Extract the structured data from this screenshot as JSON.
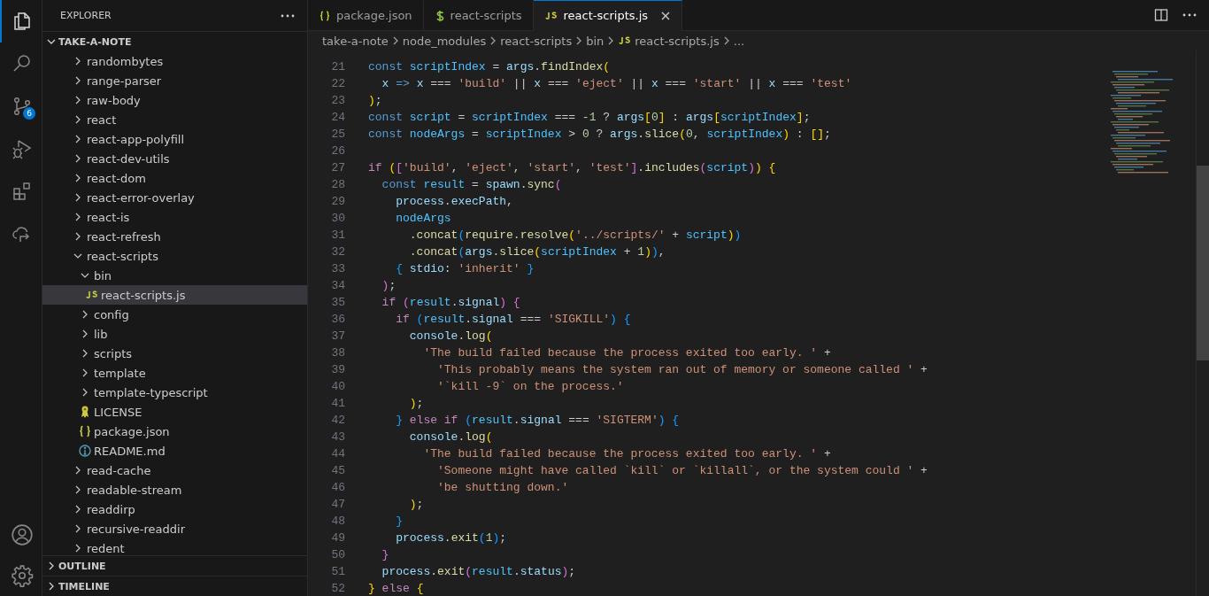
{
  "activity_bar": {
    "items": [
      {
        "kind": "explorer",
        "selected": true
      },
      {
        "kind": "search",
        "selected": false
      },
      {
        "kind": "source-control",
        "selected": false,
        "badge": "6"
      },
      {
        "kind": "run-debug",
        "selected": false
      },
      {
        "kind": "extensions",
        "selected": false
      },
      {
        "kind": "remote",
        "selected": false
      }
    ],
    "bottom": [
      {
        "kind": "account"
      },
      {
        "kind": "settings"
      }
    ]
  },
  "sidebar": {
    "title": "EXPLORER",
    "sections": [
      {
        "title": "TAKE-A-NOTE",
        "expanded": true,
        "tree": [
          {
            "label": "randombytes",
            "kind": "folder",
            "expanded": false,
            "selected": false
          },
          {
            "label": "range-parser",
            "kind": "folder",
            "expanded": false,
            "selected": false
          },
          {
            "label": "raw-body",
            "kind": "folder",
            "expanded": false,
            "selected": false
          },
          {
            "label": "react",
            "kind": "folder",
            "expanded": false,
            "selected": false
          },
          {
            "label": "react-app-polyfill",
            "kind": "folder",
            "expanded": false,
            "selected": false
          },
          {
            "label": "react-dev-utils",
            "kind": "folder",
            "expanded": false,
            "selected": false
          },
          {
            "label": "react-dom",
            "kind": "folder",
            "expanded": false,
            "selected": false
          },
          {
            "label": "react-error-overlay",
            "kind": "folder",
            "expanded": false,
            "selected": false
          },
          {
            "label": "react-is",
            "kind": "folder",
            "expanded": false,
            "selected": false
          },
          {
            "label": "react-refresh",
            "kind": "folder",
            "expanded": false,
            "selected": false
          },
          {
            "label": "react-scripts",
            "kind": "folder",
            "expanded": true,
            "selected": false,
            "children": [
              {
                "label": "bin",
                "kind": "folder",
                "expanded": true,
                "selected": false,
                "children": [
                  {
                    "label": "react-scripts.js",
                    "kind": "js",
                    "selected": true
                  }
                ]
              },
              {
                "label": "config",
                "kind": "folder",
                "expanded": false,
                "selected": false
              },
              {
                "label": "lib",
                "kind": "folder",
                "expanded": false,
                "selected": false
              },
              {
                "label": "scripts",
                "kind": "folder",
                "expanded": false,
                "selected": false
              },
              {
                "label": "template",
                "kind": "folder",
                "expanded": false,
                "selected": false
              },
              {
                "label": "template-typescript",
                "kind": "folder",
                "expanded": false,
                "selected": false
              },
              {
                "label": "LICENSE",
                "kind": "license",
                "selected": false
              },
              {
                "label": "package.json",
                "kind": "json",
                "selected": false
              },
              {
                "label": "README.md",
                "kind": "readme",
                "selected": false
              }
            ]
          },
          {
            "label": "read-cache",
            "kind": "folder",
            "expanded": false,
            "selected": false
          },
          {
            "label": "readable-stream",
            "kind": "folder",
            "expanded": false,
            "selected": false
          },
          {
            "label": "readdirp",
            "kind": "folder",
            "expanded": false,
            "selected": false
          },
          {
            "label": "recursive-readdir",
            "kind": "folder",
            "expanded": false,
            "selected": false
          },
          {
            "label": "redent",
            "kind": "folder",
            "expanded": false,
            "selected": false
          }
        ]
      },
      {
        "title": "OUTLINE",
        "expanded": false
      },
      {
        "title": "TIMELINE",
        "expanded": false
      }
    ]
  },
  "tabs": [
    {
      "label": "package.json",
      "kind": "json",
      "selected": false
    },
    {
      "label": "react-scripts",
      "kind": "shell",
      "selected": false
    },
    {
      "label": "react-scripts.js",
      "kind": "js",
      "selected": true
    }
  ],
  "breadcrumb": [
    {
      "label": "take-a-note"
    },
    {
      "label": "node_modules"
    },
    {
      "label": "react-scripts"
    },
    {
      "label": "bin"
    },
    {
      "label": "react-scripts.js",
      "kind": "js"
    },
    {
      "label": "..."
    }
  ],
  "editor": {
    "lines": [
      {
        "number": "21",
        "tokens": [
          {
            "kind": "keyword",
            "text": "const "
          },
          {
            "kind": "constant",
            "text": "scriptIndex"
          },
          {
            "kind": "plain",
            "text": " = "
          },
          {
            "kind": "variable",
            "text": "args"
          },
          {
            "kind": "plain",
            "text": "."
          },
          {
            "kind": "function",
            "text": "findIndex"
          },
          {
            "kind": "bracket1",
            "text": "("
          }
        ]
      },
      {
        "number": "22",
        "tokens": [
          {
            "kind": "variable",
            "text": "  x"
          },
          {
            "kind": "keyword",
            "text": " => "
          },
          {
            "kind": "variable",
            "text": "x"
          },
          {
            "kind": "plain",
            "text": " === "
          },
          {
            "kind": "string",
            "text": "'build'"
          },
          {
            "kind": "plain",
            "text": " || "
          },
          {
            "kind": "variable",
            "text": "x"
          },
          {
            "kind": "plain",
            "text": " === "
          },
          {
            "kind": "string",
            "text": "'eject'"
          },
          {
            "kind": "plain",
            "text": " || "
          },
          {
            "kind": "variable",
            "text": "x"
          },
          {
            "kind": "plain",
            "text": " === "
          },
          {
            "kind": "string",
            "text": "'start'"
          },
          {
            "kind": "plain",
            "text": " || "
          },
          {
            "kind": "variable",
            "text": "x"
          },
          {
            "kind": "plain",
            "text": " === "
          },
          {
            "kind": "string",
            "text": "'test'"
          }
        ]
      },
      {
        "number": "23",
        "tokens": [
          {
            "kind": "bracket1",
            "text": ")"
          },
          {
            "kind": "plain",
            "text": ";"
          }
        ]
      },
      {
        "number": "24",
        "tokens": [
          {
            "kind": "keyword",
            "text": "const "
          },
          {
            "kind": "constant",
            "text": "script"
          },
          {
            "kind": "plain",
            "text": " = "
          },
          {
            "kind": "constant",
            "text": "scriptIndex"
          },
          {
            "kind": "plain",
            "text": " === -"
          },
          {
            "kind": "number",
            "text": "1"
          },
          {
            "kind": "plain",
            "text": " ? "
          },
          {
            "kind": "variable",
            "text": "args"
          },
          {
            "kind": "bracket1",
            "text": "["
          },
          {
            "kind": "number",
            "text": "0"
          },
          {
            "kind": "bracket1",
            "text": "]"
          },
          {
            "kind": "plain",
            "text": " : "
          },
          {
            "kind": "variable",
            "text": "args"
          },
          {
            "kind": "bracket1",
            "text": "["
          },
          {
            "kind": "constant",
            "text": "scriptIndex"
          },
          {
            "kind": "bracket1",
            "text": "]"
          },
          {
            "kind": "plain",
            "text": ";"
          }
        ]
      },
      {
        "number": "25",
        "tokens": [
          {
            "kind": "keyword",
            "text": "const "
          },
          {
            "kind": "constant",
            "text": "nodeArgs"
          },
          {
            "kind": "plain",
            "text": " = "
          },
          {
            "kind": "constant",
            "text": "scriptIndex"
          },
          {
            "kind": "plain",
            "text": " > "
          },
          {
            "kind": "number",
            "text": "0"
          },
          {
            "kind": "plain",
            "text": " ? "
          },
          {
            "kind": "variable",
            "text": "args"
          },
          {
            "kind": "plain",
            "text": "."
          },
          {
            "kind": "function",
            "text": "slice"
          },
          {
            "kind": "bracket1",
            "text": "("
          },
          {
            "kind": "number",
            "text": "0"
          },
          {
            "kind": "plain",
            "text": ", "
          },
          {
            "kind": "constant",
            "text": "scriptIndex"
          },
          {
            "kind": "bracket1",
            "text": ")"
          },
          {
            "kind": "plain",
            "text": " : "
          },
          {
            "kind": "bracket1",
            "text": "[]"
          },
          {
            "kind": "plain",
            "text": ";"
          }
        ]
      },
      {
        "number": "26"
      },
      {
        "number": "27",
        "tokens": [
          {
            "kind": "control",
            "text": "if "
          },
          {
            "kind": "bracket1",
            "text": "("
          },
          {
            "kind": "bracket2",
            "text": "["
          },
          {
            "kind": "string",
            "text": "'build'"
          },
          {
            "kind": "plain",
            "text": ", "
          },
          {
            "kind": "string",
            "text": "'eject'"
          },
          {
            "kind": "plain",
            "text": ", "
          },
          {
            "kind": "string",
            "text": "'start'"
          },
          {
            "kind": "plain",
            "text": ", "
          },
          {
            "kind": "string",
            "text": "'test'"
          },
          {
            "kind": "bracket2",
            "text": "]"
          },
          {
            "kind": "plain",
            "text": "."
          },
          {
            "kind": "function",
            "text": "includes"
          },
          {
            "kind": "bracket2",
            "text": "("
          },
          {
            "kind": "constant",
            "text": "script"
          },
          {
            "kind": "bracket2",
            "text": ")"
          },
          {
            "kind": "bracket1",
            "text": ") {"
          }
        ]
      },
      {
        "number": "28",
        "tokens": [
          {
            "kind": "keyword",
            "text": "  const "
          },
          {
            "kind": "constant",
            "text": "result"
          },
          {
            "kind": "plain",
            "text": " = "
          },
          {
            "kind": "variable",
            "text": "spawn"
          },
          {
            "kind": "plain",
            "text": "."
          },
          {
            "kind": "function",
            "text": "sync"
          },
          {
            "kind": "bracket2",
            "text": "("
          }
        ]
      },
      {
        "number": "29",
        "tokens": [
          {
            "kind": "variable",
            "text": "    process"
          },
          {
            "kind": "plain",
            "text": "."
          },
          {
            "kind": "variable",
            "text": "execPath"
          },
          {
            "kind": "plain",
            "text": ","
          }
        ]
      },
      {
        "number": "30",
        "tokens": [
          {
            "kind": "constant",
            "text": "    nodeArgs"
          }
        ]
      },
      {
        "number": "31",
        "tokens": [
          {
            "kind": "plain",
            "text": "      ."
          },
          {
            "kind": "function",
            "text": "concat"
          },
          {
            "kind": "bracket3",
            "text": "("
          },
          {
            "kind": "function",
            "text": "require"
          },
          {
            "kind": "plain",
            "text": "."
          },
          {
            "kind": "function",
            "text": "resolve"
          },
          {
            "kind": "bracket1",
            "text": "("
          },
          {
            "kind": "string",
            "text": "'../scripts/'"
          },
          {
            "kind": "plain",
            "text": " + "
          },
          {
            "kind": "constant",
            "text": "script"
          },
          {
            "kind": "bracket1",
            "text": ")"
          },
          {
            "kind": "bracket3",
            "text": ")"
          }
        ]
      },
      {
        "number": "32",
        "tokens": [
          {
            "kind": "plain",
            "text": "      ."
          },
          {
            "kind": "function",
            "text": "concat"
          },
          {
            "kind": "bracket3",
            "text": "("
          },
          {
            "kind": "variable",
            "text": "args"
          },
          {
            "kind": "plain",
            "text": "."
          },
          {
            "kind": "function",
            "text": "slice"
          },
          {
            "kind": "bracket1",
            "text": "("
          },
          {
            "kind": "constant",
            "text": "scriptIndex"
          },
          {
            "kind": "plain",
            "text": " + "
          },
          {
            "kind": "number",
            "text": "1"
          },
          {
            "kind": "bracket1",
            "text": ")"
          },
          {
            "kind": "bracket3",
            "text": ")"
          },
          {
            "kind": "plain",
            "text": ","
          }
        ]
      },
      {
        "number": "33",
        "tokens": [
          {
            "kind": "bracket3",
            "text": "    {"
          },
          {
            "kind": "variable",
            "text": " stdio"
          },
          {
            "kind": "plain",
            "text": ": "
          },
          {
            "kind": "string",
            "text": "'inherit'"
          },
          {
            "kind": "bracket3",
            "text": " }"
          }
        ]
      },
      {
        "number": "34",
        "tokens": [
          {
            "kind": "bracket2",
            "text": "  )"
          },
          {
            "kind": "plain",
            "text": ";"
          }
        ]
      },
      {
        "number": "35",
        "tokens": [
          {
            "kind": "control",
            "text": "  if "
          },
          {
            "kind": "bracket2",
            "text": "("
          },
          {
            "kind": "constant",
            "text": "result"
          },
          {
            "kind": "plain",
            "text": "."
          },
          {
            "kind": "variable",
            "text": "signal"
          },
          {
            "kind": "bracket2",
            "text": ") {"
          }
        ]
      },
      {
        "number": "36",
        "tokens": [
          {
            "kind": "control",
            "text": "    if "
          },
          {
            "kind": "bracket3",
            "text": "("
          },
          {
            "kind": "constant",
            "text": "result"
          },
          {
            "kind": "plain",
            "text": "."
          },
          {
            "kind": "variable",
            "text": "signal"
          },
          {
            "kind": "plain",
            "text": " === "
          },
          {
            "kind": "string",
            "text": "'SIGKILL'"
          },
          {
            "kind": "bracket3",
            "text": ") {"
          }
        ]
      },
      {
        "number": "37",
        "tokens": [
          {
            "kind": "variable",
            "text": "      console"
          },
          {
            "kind": "plain",
            "text": "."
          },
          {
            "kind": "function",
            "text": "log"
          },
          {
            "kind": "bracket1",
            "text": "("
          }
        ]
      },
      {
        "number": "38",
        "tokens": [
          {
            "kind": "string",
            "text": "        'The build failed because the process exited too early. '"
          },
          {
            "kind": "plain",
            "text": " +"
          }
        ]
      },
      {
        "number": "39",
        "tokens": [
          {
            "kind": "string",
            "text": "          'This probably means the system ran out of memory or someone called '"
          },
          {
            "kind": "plain",
            "text": " +"
          }
        ]
      },
      {
        "number": "40",
        "tokens": [
          {
            "kind": "string",
            "text": "          '`kill -9` on the process.'"
          }
        ]
      },
      {
        "number": "41",
        "tokens": [
          {
            "kind": "bracket1",
            "text": "      )"
          },
          {
            "kind": "plain",
            "text": ";"
          }
        ]
      },
      {
        "number": "42",
        "tokens": [
          {
            "kind": "bracket3",
            "text": "    }"
          },
          {
            "kind": "control",
            "text": " else if "
          },
          {
            "kind": "bracket3",
            "text": "("
          },
          {
            "kind": "constant",
            "text": "result"
          },
          {
            "kind": "plain",
            "text": "."
          },
          {
            "kind": "variable",
            "text": "signal"
          },
          {
            "kind": "plain",
            "text": " === "
          },
          {
            "kind": "string",
            "text": "'SIGTERM'"
          },
          {
            "kind": "bracket3",
            "text": ") {"
          }
        ]
      },
      {
        "number": "43",
        "tokens": [
          {
            "kind": "variable",
            "text": "      console"
          },
          {
            "kind": "plain",
            "text": "."
          },
          {
            "kind": "function",
            "text": "log"
          },
          {
            "kind": "bracket1",
            "text": "("
          }
        ]
      },
      {
        "number": "44",
        "tokens": [
          {
            "kind": "string",
            "text": "        'The build failed because the process exited too early. '"
          },
          {
            "kind": "plain",
            "text": " +"
          }
        ]
      },
      {
        "number": "45",
        "tokens": [
          {
            "kind": "string",
            "text": "          'Someone might have called `kill` or `killall`, or the system could '"
          },
          {
            "kind": "plain",
            "text": " +"
          }
        ]
      },
      {
        "number": "46",
        "tokens": [
          {
            "kind": "string",
            "text": "          'be shutting down.'"
          }
        ]
      },
      {
        "number": "47",
        "tokens": [
          {
            "kind": "bracket1",
            "text": "      )"
          },
          {
            "kind": "plain",
            "text": ";"
          }
        ]
      },
      {
        "number": "48",
        "tokens": [
          {
            "kind": "bracket3",
            "text": "    }"
          }
        ]
      },
      {
        "number": "49",
        "tokens": [
          {
            "kind": "variable",
            "text": "    process"
          },
          {
            "kind": "plain",
            "text": "."
          },
          {
            "kind": "function",
            "text": "exit"
          },
          {
            "kind": "bracket3",
            "text": "("
          },
          {
            "kind": "number",
            "text": "1"
          },
          {
            "kind": "bracket3",
            "text": ")"
          },
          {
            "kind": "plain",
            "text": ";"
          }
        ]
      },
      {
        "number": "50",
        "tokens": [
          {
            "kind": "bracket2",
            "text": "  }"
          }
        ]
      },
      {
        "number": "51",
        "tokens": [
          {
            "kind": "variable",
            "text": "  process"
          },
          {
            "kind": "plain",
            "text": "."
          },
          {
            "kind": "function",
            "text": "exit"
          },
          {
            "kind": "bracket2",
            "text": "("
          },
          {
            "kind": "constant",
            "text": "result"
          },
          {
            "kind": "plain",
            "text": "."
          },
          {
            "kind": "variable",
            "text": "status"
          },
          {
            "kind": "bracket2",
            "text": ")"
          },
          {
            "kind": "plain",
            "text": ";"
          }
        ]
      },
      {
        "number": "52",
        "tokens": [
          {
            "kind": "bracket1",
            "text": "}"
          },
          {
            "kind": "control",
            "text": " else "
          },
          {
            "kind": "bracket1",
            "text": "{"
          }
        ]
      }
    ]
  }
}
